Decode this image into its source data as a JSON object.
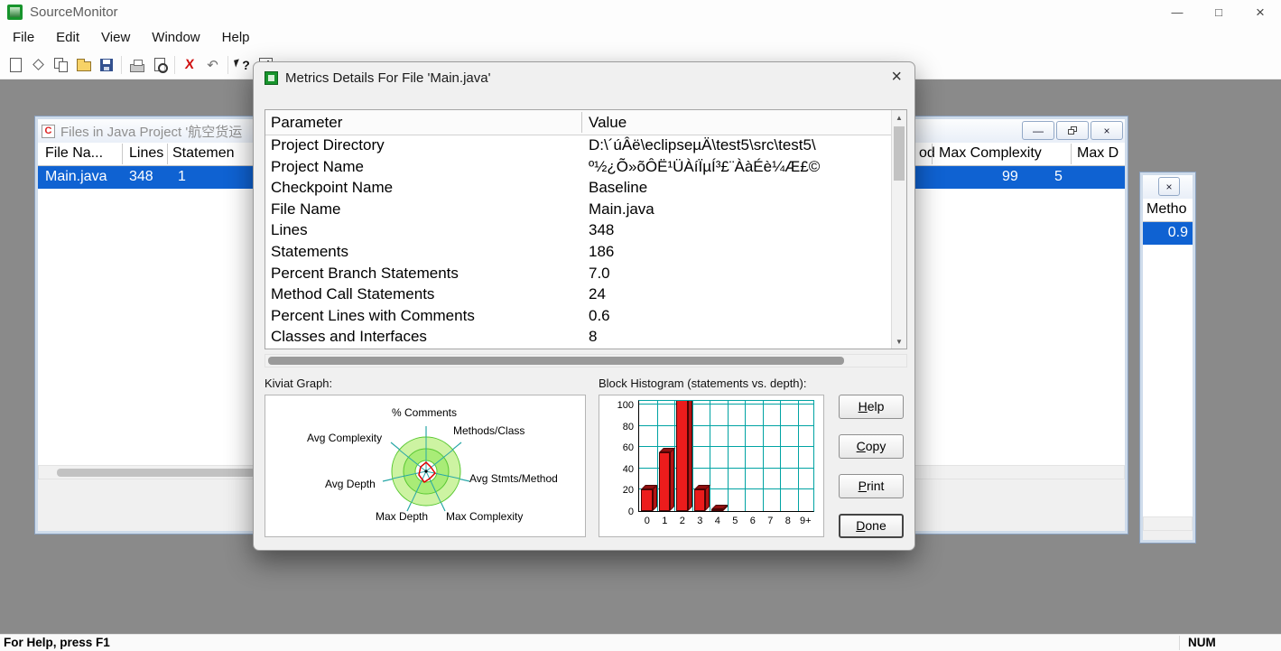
{
  "app": {
    "title": "SourceMonitor",
    "status": {
      "left": "For Help, press F1",
      "right": "NUM"
    }
  },
  "icons": {
    "minimize": "—",
    "maximize": "□",
    "close": "×",
    "delete": "X",
    "undo": "↶",
    "help": "?",
    "scroll_up": "▲",
    "scroll_down": "▼"
  },
  "menu": {
    "items": [
      {
        "label": "File"
      },
      {
        "label": "Edit"
      },
      {
        "label": "View"
      },
      {
        "label": "Window"
      },
      {
        "label": "Help"
      }
    ]
  },
  "toolbar": {
    "icons": [
      "new-file",
      "checkpoint-diamond",
      "copy",
      "open-folder",
      "save",
      "print",
      "print-preview",
      "delete",
      "undo",
      "context-help",
      "metrics-detail"
    ]
  },
  "files_window": {
    "title": "Files in Java Project '航空货运",
    "left_columns": [
      "File Na...",
      "Lines",
      "Statemen"
    ],
    "left_row": [
      "Main.java",
      "348",
      "1"
    ],
    "right_columns": [
      "od",
      "Max Complexity",
      "Max D"
    ],
    "right_row": [
      "99",
      "5"
    ]
  },
  "side_window": {
    "column": "Metho",
    "value": "0.9"
  },
  "dialog": {
    "title": "Metrics Details For File 'Main.java'",
    "table": {
      "col_param": "Parameter",
      "col_value": "Value",
      "rows": [
        {
          "param": "Project Directory",
          "value": "D:\\´úÂë\\eclipseµÄ\\test5\\src\\test5\\"
        },
        {
          "param": "Project Name",
          "value": "º½¿Õ»õÔË¹ÜÀíÏµÍ³£¨ÀàÉè¼Æ£©"
        },
        {
          "param": "Checkpoint Name",
          "value": "Baseline"
        },
        {
          "param": "File Name",
          "value": "Main.java"
        },
        {
          "param": "Lines",
          "value": "348"
        },
        {
          "param": "Statements",
          "value": "186"
        },
        {
          "param": "Percent Branch Statements",
          "value": "7.0"
        },
        {
          "param": "Method Call Statements",
          "value": "24"
        },
        {
          "param": "Percent Lines with Comments",
          "value": "0.6"
        },
        {
          "param": "Classes and Interfaces",
          "value": "8"
        }
      ]
    },
    "kiviat_label": "Kiviat Graph:",
    "histogram_label": "Block Histogram (statements vs. depth):",
    "buttons": [
      {
        "label": "Help"
      },
      {
        "label": "Copy"
      },
      {
        "label": "Print"
      },
      {
        "label": "Done"
      }
    ]
  },
  "chart_data": [
    {
      "type": "radar",
      "title": "Kiviat Graph",
      "axes": [
        "% Comments",
        "Methods/Class",
        "Avg Stmts/Method",
        "Max Complexity",
        "Max Depth",
        "Avg Depth",
        "Avg Complexity"
      ],
      "rings": 3,
      "ring_color": "#8ddc55",
      "spoke_color": "#28a7a7",
      "data_polygon_color": "#e00000"
    },
    {
      "type": "bar",
      "title": "Block Histogram (statements vs. depth)",
      "categories": [
        "0",
        "1",
        "2",
        "3",
        "4",
        "5",
        "6",
        "7",
        "8",
        "9+"
      ],
      "values": [
        20,
        55,
        105,
        20,
        2,
        0,
        0,
        0,
        0,
        0
      ],
      "xlabel": "depth",
      "ylabel": "statements",
      "ylim": [
        0,
        100
      ],
      "yticks": [
        0,
        20,
        40,
        60,
        80,
        100
      ],
      "grid": true,
      "bar_color": "#ec1c1c",
      "grid_color": "#00a3a3"
    }
  ],
  "colors": {
    "selection_blue": "#0f62d2",
    "desktop_gray": "#8a8a8a",
    "bar_red": "#ec1c1c",
    "grid_teal": "#00a3a3",
    "kiviat_green": "#8ddc55"
  }
}
